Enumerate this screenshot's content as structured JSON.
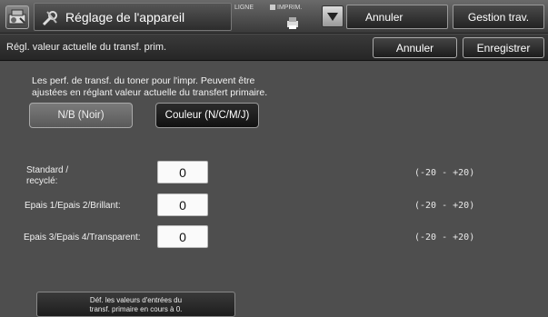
{
  "header": {
    "title": "Réglage de l'appareil",
    "line_label": "LIGNE",
    "print_label": "IMPRIM.",
    "cancel_label": "Annuler",
    "jobs_label": "Gestion trav."
  },
  "subheader": {
    "title": "Régl. valeur actuelle du transf. prim.",
    "cancel_label": "Annuler",
    "save_label": "Enregistrer"
  },
  "main": {
    "description_line1": "Les perf. de transf. du toner pour l'impr. Peuvent être",
    "description_line2": "ajustées en réglant valeur actuelle du transfert primaire.",
    "modes": {
      "bw_label": "N/B (Noir)",
      "color_label": "Couleur (N/C/M/J)",
      "selected": "color"
    },
    "rows": [
      {
        "label_line1": "Standard /",
        "label_line2": "recyclé:",
        "value": "0",
        "range": "(-20 - +20)"
      },
      {
        "label_line1": "Epais 1/Epais 2/Brillant:",
        "label_line2": "",
        "value": "0",
        "range": "(-20 - +20)"
      },
      {
        "label_line1": "Epais 3/Epais 4/Transparent:",
        "label_line2": "",
        "value": "0",
        "range": "(-20 - +20)"
      }
    ],
    "reset_line1": "Déf. les valeurs d'entrées du",
    "reset_line2": "transf. primaire en cours à 0."
  },
  "icons": {
    "app": "machine-settings-icon",
    "title": "tools-icon",
    "print": "printer-icon",
    "dropdown": "chevron-down-icon"
  }
}
